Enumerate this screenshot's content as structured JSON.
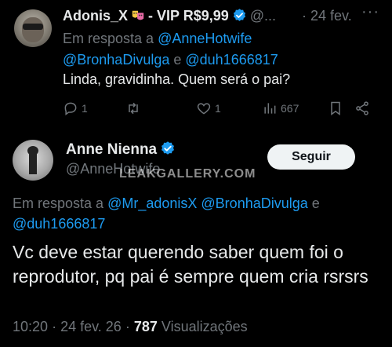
{
  "reply": {
    "author_name": "Adonis_X",
    "author_suffix": "- VIP R$9,99",
    "author_emoji": "performing-arts-emoji",
    "handle": "@...",
    "dot": "·",
    "date": "24 fev.",
    "more": "···",
    "reply_prefix": "Em resposta a ",
    "mention_1": "@AnneHotwife",
    "mention_2": "@BronhaDivulga",
    "mention_join": " e ",
    "mention_3": "@duh1666817",
    "text": "Linda, gravidinha. Quem será o pai?",
    "actions": {
      "replies": "1",
      "reposts": "",
      "likes": "1",
      "views": "667"
    }
  },
  "main": {
    "author_name": "Anne Nienna",
    "handle": "@AnneHotwife",
    "follow_label": "Seguir",
    "watermark": "LEAKGALLERY.COM",
    "reply_prefix": "Em resposta a ",
    "mention_1": "@Mr_adonisX",
    "mention_2": "@BronhaDivulga",
    "mention_join": " e ",
    "mention_3": "@duh1666817",
    "text": "Vc deve estar querendo saber quem foi o reprodutor, pq pai é sempre quem cria rsrsrs",
    "time": "10:20",
    "date": "24 fev. 26",
    "dot": "·",
    "views_count": "787",
    "views_label": "Visualizações"
  },
  "colors": {
    "background": "#000000",
    "text": "#e7e9ea",
    "muted": "#71767b",
    "link": "#1d9bf0",
    "verified": "#1d9bf0",
    "follow_bg": "#eff3f4"
  }
}
